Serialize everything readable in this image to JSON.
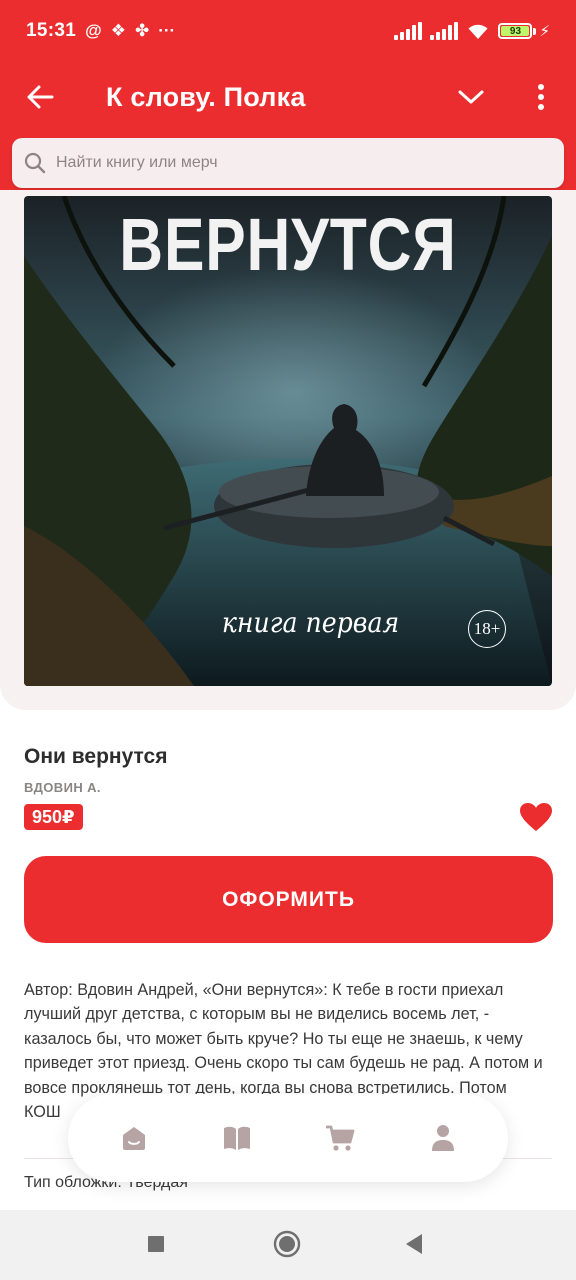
{
  "status_bar": {
    "time": "15:31",
    "icons": [
      "at-icon",
      "dropbox-icon",
      "pinwheel-icon",
      "more-dots-icon"
    ],
    "battery": "93"
  },
  "app_bar": {
    "title": "К слову. Полка"
  },
  "search": {
    "placeholder": "Найти книгу или мерч"
  },
  "cover": {
    "title": "ВЕРНУТСЯ",
    "subtitle": "книга первая",
    "age_rating": "18+"
  },
  "product": {
    "title": "Они вернутся",
    "author": "ВДОВИН А.",
    "price": "950₽",
    "order_label": "ОФОРМИТЬ",
    "description": "Автор: Вдовин Андрей, «Они вернутся»: К тебе в гости приехал лучший друг детства, с которым вы не виделись восемь лет, - казалось бы, что может быть круче? Но ты еще не знаешь, к чему приведет этот приезд. Очень скоро ты сам будешь не рад. А потом и вовсе проклянешь тот день, когда вы снова встретились. Потом",
    "description_tail": "КОШ",
    "cover_type": "Тип обложки: Твердая"
  },
  "bottom_nav": {
    "items": [
      "home-icon",
      "book-icon",
      "cart-icon",
      "profile-icon"
    ]
  },
  "colors": {
    "brand": "#ec2d2f",
    "card_bg": "#f7f1f1"
  }
}
